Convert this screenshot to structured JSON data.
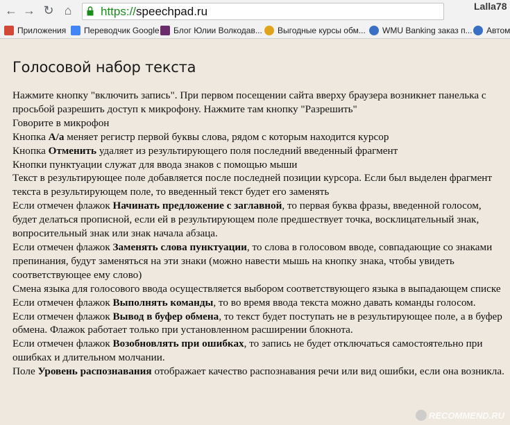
{
  "browser": {
    "url_scheme": "https://",
    "url_host": "speechpad.ru",
    "user": "Lalla78"
  },
  "bookmarks": [
    {
      "label": "Приложения",
      "icon": "apps-grid-icon",
      "color": "#d34836"
    },
    {
      "label": "Переводчик Google",
      "icon": "google-translate-icon",
      "color": "#4285f4"
    },
    {
      "label": "Блог Юлии Волкодав...",
      "icon": "blog-icon",
      "color": "#6b2c6b"
    },
    {
      "label": "Выгодные курсы обм...",
      "icon": "exchange-icon",
      "color": "#e0a41a"
    },
    {
      "label": "WMU Banking заказ п...",
      "icon": "globe-icon",
      "color": "#3a6fc4"
    },
    {
      "label": "Автома",
      "icon": "globe-icon",
      "color": "#3a6fc4"
    }
  ],
  "page": {
    "title": "Голосовой набор текста",
    "paragraphs": [
      {
        "parts": [
          {
            "t": "Нажмите кнопку \"включить запись\". При первом посещении сайта вверху браузера возникнет панелька с просьбой разрешить доступ к микрофону. Нажмите там кнопку \"Разрешить\""
          }
        ]
      },
      {
        "parts": [
          {
            "t": "Говорите в микрофон"
          }
        ]
      },
      {
        "parts": [
          {
            "t": "Кнопка "
          },
          {
            "t": "A/a",
            "b": true
          },
          {
            "t": " меняет регистр первой буквы слова, рядом с которым находится курсор"
          }
        ]
      },
      {
        "parts": [
          {
            "t": "Кнопка "
          },
          {
            "t": "Отменить",
            "b": true
          },
          {
            "t": " удаляет из результирующего поля последний введенный фрагмент"
          }
        ]
      },
      {
        "parts": [
          {
            "t": "Кнопки пунктуации служат для ввода знаков с помощью мыши"
          }
        ]
      },
      {
        "parts": [
          {
            "t": "Текст в результирующее поле добавляется после последней позиции курсора. Если был выделен фрагмент текста в результирующем поле, то введенный текст будет его заменять"
          }
        ]
      },
      {
        "parts": [
          {
            "t": "Если отмечен флажок "
          },
          {
            "t": "Начинать предложение с заглавной",
            "b": true
          },
          {
            "t": ", то первая буква фразы, введенной голосом, будет делаться прописной, если ей в результирующем поле предшествует точка, восклицательный знак, вопросительный знак или знак начала абзаца."
          }
        ]
      },
      {
        "parts": [
          {
            "t": "Если отмечен флажок "
          },
          {
            "t": "Заменять слова пунктуации",
            "b": true
          },
          {
            "t": ", то слова в голосовом вводе, совпадающие со знаками препинания, будут заменяться на эти знаки (можно навести мышь на кнопку знака, чтобы увидеть соответствующее ему слово)"
          }
        ]
      },
      {
        "parts": [
          {
            "t": "Смена языка для голосового ввода осуществляется выбором соответствующего языка в выпадающем списке"
          }
        ]
      },
      {
        "parts": [
          {
            "t": "Если отмечен флажок "
          },
          {
            "t": "Выполнять команды",
            "b": true
          },
          {
            "t": ", то во время ввода текста можно давать команды голосом."
          }
        ]
      },
      {
        "parts": [
          {
            "t": "Если отмечен флажок "
          },
          {
            "t": "Вывод в буфер обмена",
            "b": true
          },
          {
            "t": ", то текст будет поступать не в результирующее поле, а в буфер обмена. Флажок работает только при установленном расширении блокнота."
          }
        ]
      },
      {
        "parts": [
          {
            "t": "Если отмечен флажок "
          },
          {
            "t": "Возобновлять при ошибках",
            "b": true
          },
          {
            "t": ", то запись не будет отключаться самостоятельно при ошибках и длительном молчании."
          }
        ]
      },
      {
        "parts": [
          {
            "t": "Поле "
          },
          {
            "t": "Уровень распознавания",
            "b": true
          },
          {
            "t": " отображает качество распознавания речи или вид ошибки, если она возникла."
          }
        ]
      }
    ]
  },
  "watermark": {
    "text": "RECOMMEND.RU"
  }
}
